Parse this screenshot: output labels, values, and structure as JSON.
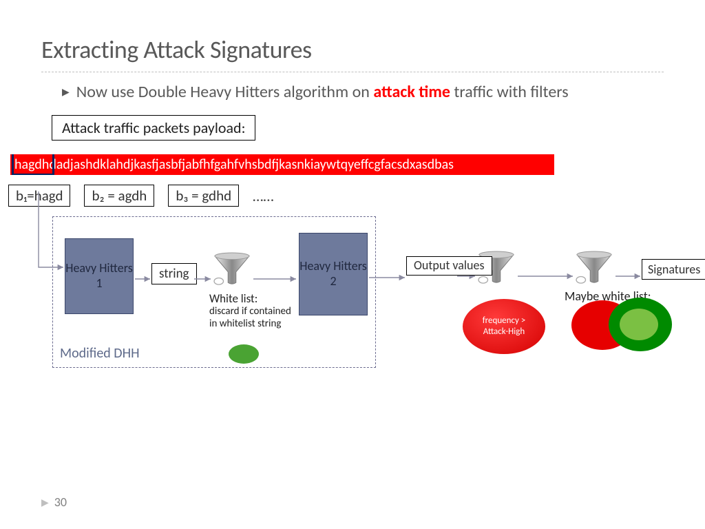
{
  "title": "Extracting Attack Signatures",
  "bullet": {
    "pre": "Now use Double Heavy Hitters algorithm on ",
    "emph": "attack time",
    "post": " traffic with filters"
  },
  "payload_label": "Attack traffic packets payload:",
  "payload_string": "hagdhdadjashdklahdjkasfjasbfjabfhfgahfvhsbdfjkasnkiaywtqyeffcgfacsdxasdbas",
  "b_boxes": {
    "b1": "b₁=hagd",
    "b2": "b₂ = agdh",
    "b3": "b₃ = gdhd",
    "more": "……"
  },
  "diagram": {
    "hh1": "Heavy Hitters 1",
    "hh2": "Heavy Hitters 2",
    "string_label": "string",
    "output_values": "Output values",
    "signatures": "Signatures",
    "dhh_label": "Modified DHH",
    "whitelist_heading": "White list:",
    "whitelist_body": "discard if contained in whitelist string",
    "maybe_whitelist": "Maybe white list:",
    "freq_bubble": "frequency > Attack-High"
  },
  "page_number": "30"
}
